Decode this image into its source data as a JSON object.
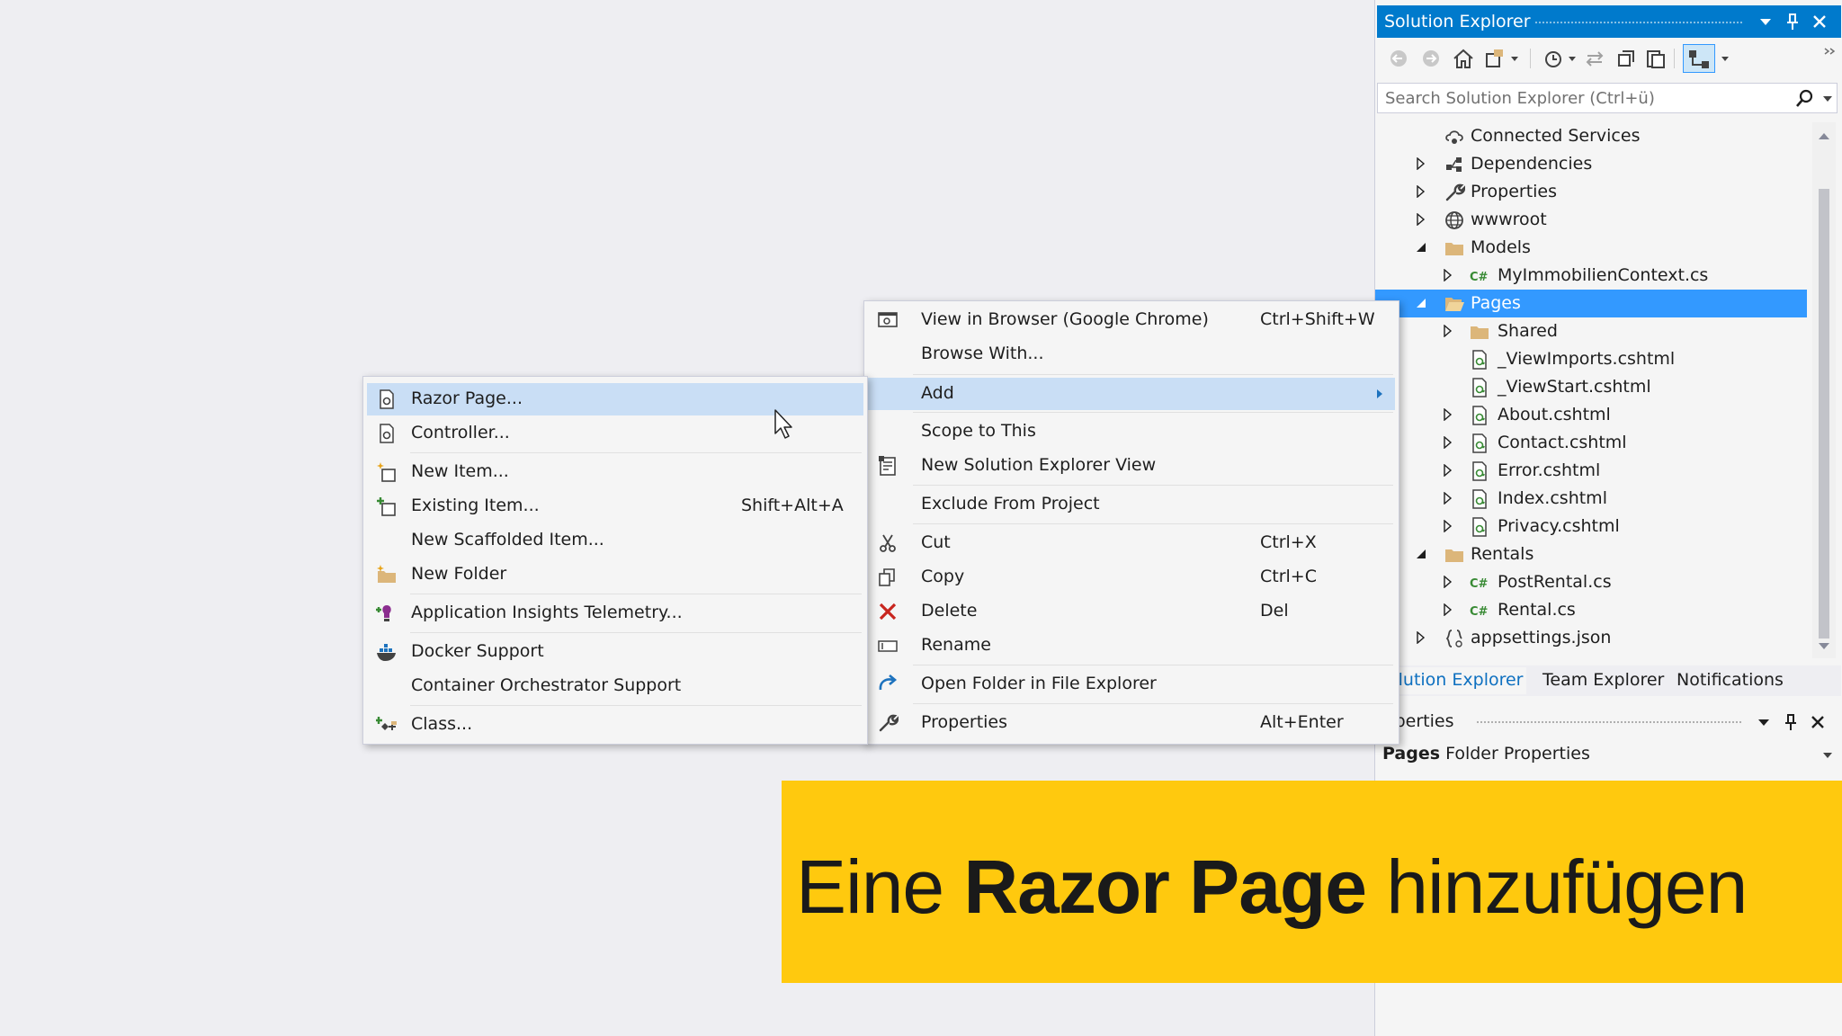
{
  "solution_explorer": {
    "title": "Solution Explorer",
    "search_placeholder": "Search Solution Explorer (Ctrl+ü)",
    "tree": [
      {
        "label": "Connected Services",
        "icon": "connected-services-icon",
        "arrow": "none",
        "indent": 0
      },
      {
        "label": "Dependencies",
        "icon": "dependencies-icon",
        "arrow": "collapsed",
        "indent": 0
      },
      {
        "label": "Properties",
        "icon": "wrench-icon",
        "arrow": "collapsed",
        "indent": 0
      },
      {
        "label": "wwwroot",
        "icon": "globe-icon",
        "arrow": "collapsed",
        "indent": 0
      },
      {
        "label": "Models",
        "icon": "folder-icon",
        "arrow": "expanded",
        "indent": 0
      },
      {
        "label": "MyImmobilienContext.cs",
        "icon": "csharp-file-icon",
        "arrow": "collapsed",
        "indent": 1
      },
      {
        "label": "Pages",
        "icon": "folder-open-icon",
        "arrow": "expanded",
        "indent": 0,
        "selected": true
      },
      {
        "label": "Shared",
        "icon": "folder-icon",
        "arrow": "collapsed",
        "indent": 1
      },
      {
        "label": "_ViewImports.cshtml",
        "icon": "razor-file-icon",
        "arrow": "none",
        "indent": 1
      },
      {
        "label": "_ViewStart.cshtml",
        "icon": "razor-file-icon",
        "arrow": "none",
        "indent": 1
      },
      {
        "label": "About.cshtml",
        "icon": "razor-file-icon",
        "arrow": "collapsed",
        "indent": 1
      },
      {
        "label": "Contact.cshtml",
        "icon": "razor-file-icon",
        "arrow": "collapsed",
        "indent": 1
      },
      {
        "label": "Error.cshtml",
        "icon": "razor-file-icon",
        "arrow": "collapsed",
        "indent": 1
      },
      {
        "label": "Index.cshtml",
        "icon": "razor-file-icon",
        "arrow": "collapsed",
        "indent": 1
      },
      {
        "label": "Privacy.cshtml",
        "icon": "razor-file-icon",
        "arrow": "collapsed",
        "indent": 1
      },
      {
        "label": "Rentals",
        "icon": "folder-icon",
        "arrow": "expanded",
        "indent": 0
      },
      {
        "label": "PostRental.cs",
        "icon": "csharp-file-icon",
        "arrow": "collapsed",
        "indent": 1
      },
      {
        "label": "Rental.cs",
        "icon": "csharp-file-icon",
        "arrow": "collapsed",
        "indent": 1
      },
      {
        "label": "appsettings.json",
        "icon": "json-file-icon",
        "arrow": "collapsed",
        "indent": 0
      }
    ],
    "tabs": [
      "olution Explorer",
      "Team Explorer",
      "Notifications"
    ],
    "properties_title": "operties",
    "properties_object": "Pages",
    "properties_type": "Folder Properties"
  },
  "context_menu": {
    "items": [
      {
        "label": "View in Browser (Google Chrome)",
        "shortcut": "Ctrl+Shift+W",
        "icon": "browser-view-icon"
      },
      {
        "label": "Browse With...",
        "shortcut": "",
        "icon": ""
      },
      {
        "label": "Add",
        "shortcut": "",
        "icon": "",
        "submenu": true,
        "highlighted": true
      },
      {
        "label": "Scope to This",
        "shortcut": "",
        "icon": ""
      },
      {
        "label": "New Solution Explorer View",
        "shortcut": "",
        "icon": "new-view-icon"
      },
      {
        "label": "Exclude From Project",
        "shortcut": "",
        "icon": ""
      },
      {
        "label": "Cut",
        "shortcut": "Ctrl+X",
        "icon": "scissors-icon"
      },
      {
        "label": "Copy",
        "shortcut": "Ctrl+C",
        "icon": "copy-icon"
      },
      {
        "label": "Delete",
        "shortcut": "Del",
        "icon": "delete-icon"
      },
      {
        "label": "Rename",
        "shortcut": "",
        "icon": "rename-icon"
      },
      {
        "label": "Open Folder in File Explorer",
        "shortcut": "",
        "icon": "open-folder-arrow-icon"
      },
      {
        "label": "Properties",
        "shortcut": "Alt+Enter",
        "icon": "wrench-icon"
      }
    ]
  },
  "add_submenu": {
    "items": [
      {
        "label": "Razor Page...",
        "shortcut": "",
        "icon": "razor-page-icon",
        "highlighted": true
      },
      {
        "label": "Controller...",
        "shortcut": "",
        "icon": "controller-icon"
      },
      {
        "label": "New Item...",
        "shortcut": "",
        "icon": "new-item-icon"
      },
      {
        "label": "Existing Item...",
        "shortcut": "Shift+Alt+A",
        "icon": "existing-item-icon"
      },
      {
        "label": "New Scaffolded Item...",
        "shortcut": "",
        "icon": ""
      },
      {
        "label": "New Folder",
        "shortcut": "",
        "icon": "new-folder-icon"
      },
      {
        "label": "Application Insights Telemetry...",
        "shortcut": "",
        "icon": "insights-icon"
      },
      {
        "label": "Docker Support",
        "shortcut": "",
        "icon": "docker-icon"
      },
      {
        "label": "Container Orchestrator Support",
        "shortcut": "",
        "icon": ""
      },
      {
        "label": "Class...",
        "shortcut": "",
        "icon": "class-icon"
      }
    ]
  },
  "banner": {
    "prefix": "Eine ",
    "bold": "Razor Page",
    "suffix": " hinzufügen"
  },
  "colors": {
    "accent": "#007acc",
    "selection": "#3399ff",
    "menu_highlight": "#c9def5",
    "banner": "#ffc90e"
  }
}
